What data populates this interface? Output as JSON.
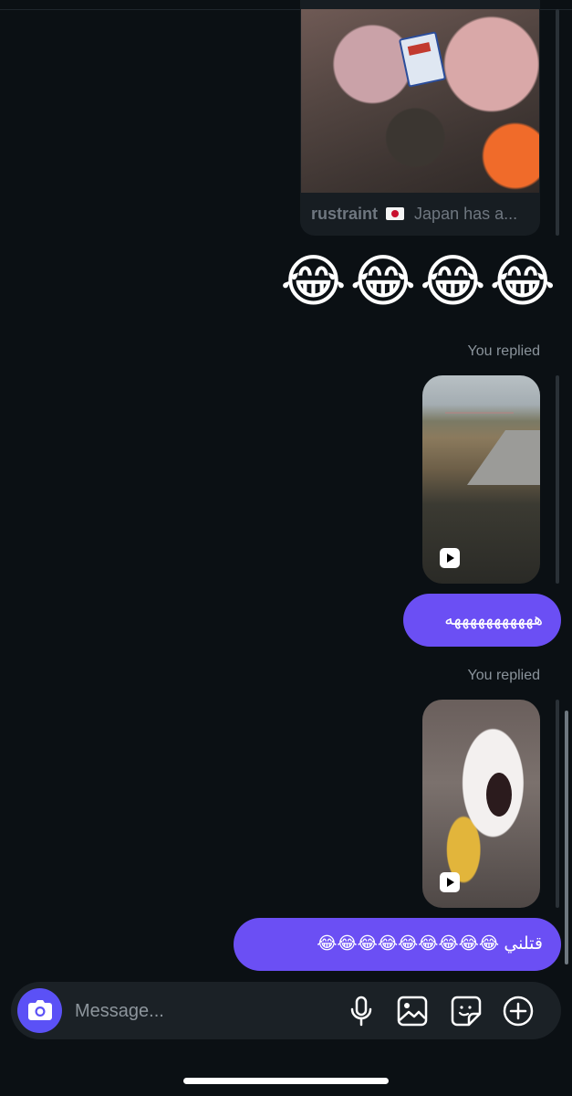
{
  "shared_post": {
    "username": "rustraint",
    "caption": "Japan has a..."
  },
  "emoji_row": "😂😂😂😂",
  "thread": {
    "replied_label_1": "You replied",
    "message_1": "هههههههههههه",
    "replied_label_2": "You replied",
    "message_2": "قتلني 😂😂😂😂😂😂😂😂😂"
  },
  "composer": {
    "placeholder": "Message..."
  },
  "colors": {
    "background": "#0b1014",
    "bubble": "#6b4ff4",
    "camera_button": "#5b51f6",
    "composer": "#1b2126",
    "muted_text": "#8a939b"
  }
}
